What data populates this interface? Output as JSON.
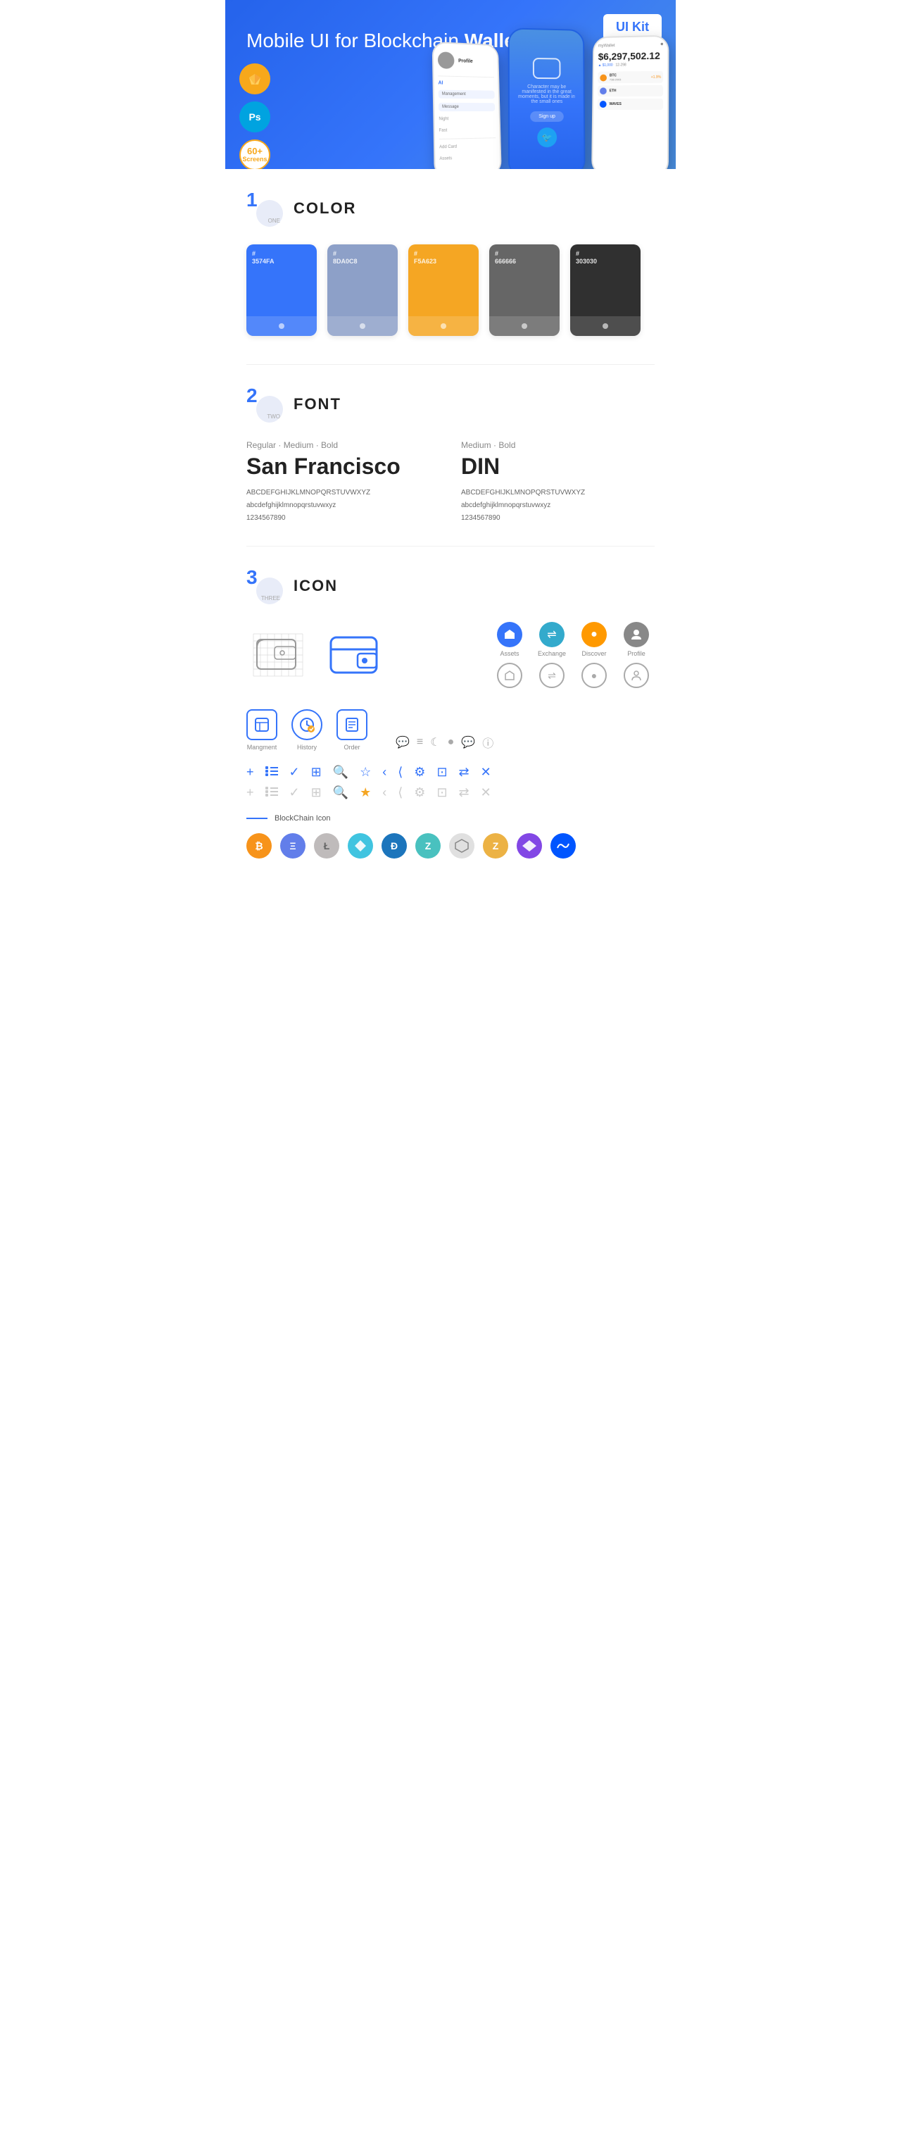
{
  "hero": {
    "title": "Mobile UI for Blockchain ",
    "title_bold": "Wallet",
    "kit_badge": "UI Kit",
    "badge_sketch": "S",
    "badge_ps": "Ps",
    "badge_screens": "60+\nScreens"
  },
  "sections": {
    "color": {
      "number": "1",
      "label": "ONE",
      "title": "COLOR",
      "swatches": [
        {
          "hex": "#3574FA",
          "code": "#\n3574FA"
        },
        {
          "hex": "#8DA0C8",
          "code": "#\n8DA0C8"
        },
        {
          "hex": "#F5A623",
          "code": "#\nF5A623"
        },
        {
          "hex": "#666666",
          "code": "#\n666666"
        },
        {
          "hex": "#303030",
          "code": "#\n303030"
        }
      ]
    },
    "font": {
      "number": "2",
      "label": "TWO",
      "title": "FONT",
      "fonts": [
        {
          "subtitle": "Regular · Medium · Bold",
          "name": "San Francisco",
          "uppercase": "ABCDEFGHIJKLMNOPQRSTUVWXYZ",
          "lowercase": "abcdefghijklmnopqrstuvwxyz",
          "numbers": "1234567890"
        },
        {
          "subtitle": "Medium · Bold",
          "name": "DIN",
          "uppercase": "ABCDEFGHIJKLMNOPQRSTUVWXYZ",
          "lowercase": "abcdefghijklmnopqrstuvwxyz",
          "numbers": "1234567890"
        }
      ]
    },
    "icon": {
      "number": "3",
      "label": "THREE",
      "title": "ICON",
      "named_icons": [
        {
          "label": "Assets",
          "symbol": "◆"
        },
        {
          "label": "Exchange",
          "symbol": "⇌"
        },
        {
          "label": "Discover",
          "symbol": "●"
        },
        {
          "label": "Profile",
          "symbol": "👤"
        }
      ],
      "app_icons": [
        {
          "label": "Mangment",
          "symbol": "▣"
        },
        {
          "label": "History",
          "symbol": "🕐"
        },
        {
          "label": "Order",
          "symbol": "📋"
        }
      ],
      "small_icons": [
        "+",
        "☰",
        "✓",
        "⊞",
        "🔍",
        "☆",
        "‹",
        "⟨",
        "⚙",
        "⊡",
        "⇄",
        "✕"
      ],
      "blockchain_label": "BlockChain Icon",
      "blockchain_icons": [
        {
          "name": "Bitcoin",
          "symbol": "₿",
          "class": "bc-btc"
        },
        {
          "name": "Ethereum",
          "symbol": "Ξ",
          "class": "bc-eth"
        },
        {
          "name": "Litecoin",
          "symbol": "Ł",
          "class": "bc-ltc"
        },
        {
          "name": "Verge",
          "symbol": "⋮",
          "class": "bc-xvg"
        },
        {
          "name": "Dash",
          "symbol": "Đ",
          "class": "bc-dash"
        },
        {
          "name": "Zilliqa",
          "symbol": "Z",
          "class": "bc-zil"
        },
        {
          "name": "IOTA",
          "symbol": "⬡",
          "class": "bc-iota"
        },
        {
          "name": "ZCash",
          "symbol": "Z",
          "class": "bc-zcash"
        },
        {
          "name": "Matic",
          "symbol": "M",
          "class": "bc-matic"
        },
        {
          "name": "Waves",
          "symbol": "≋",
          "class": "bc-waves"
        }
      ]
    }
  }
}
